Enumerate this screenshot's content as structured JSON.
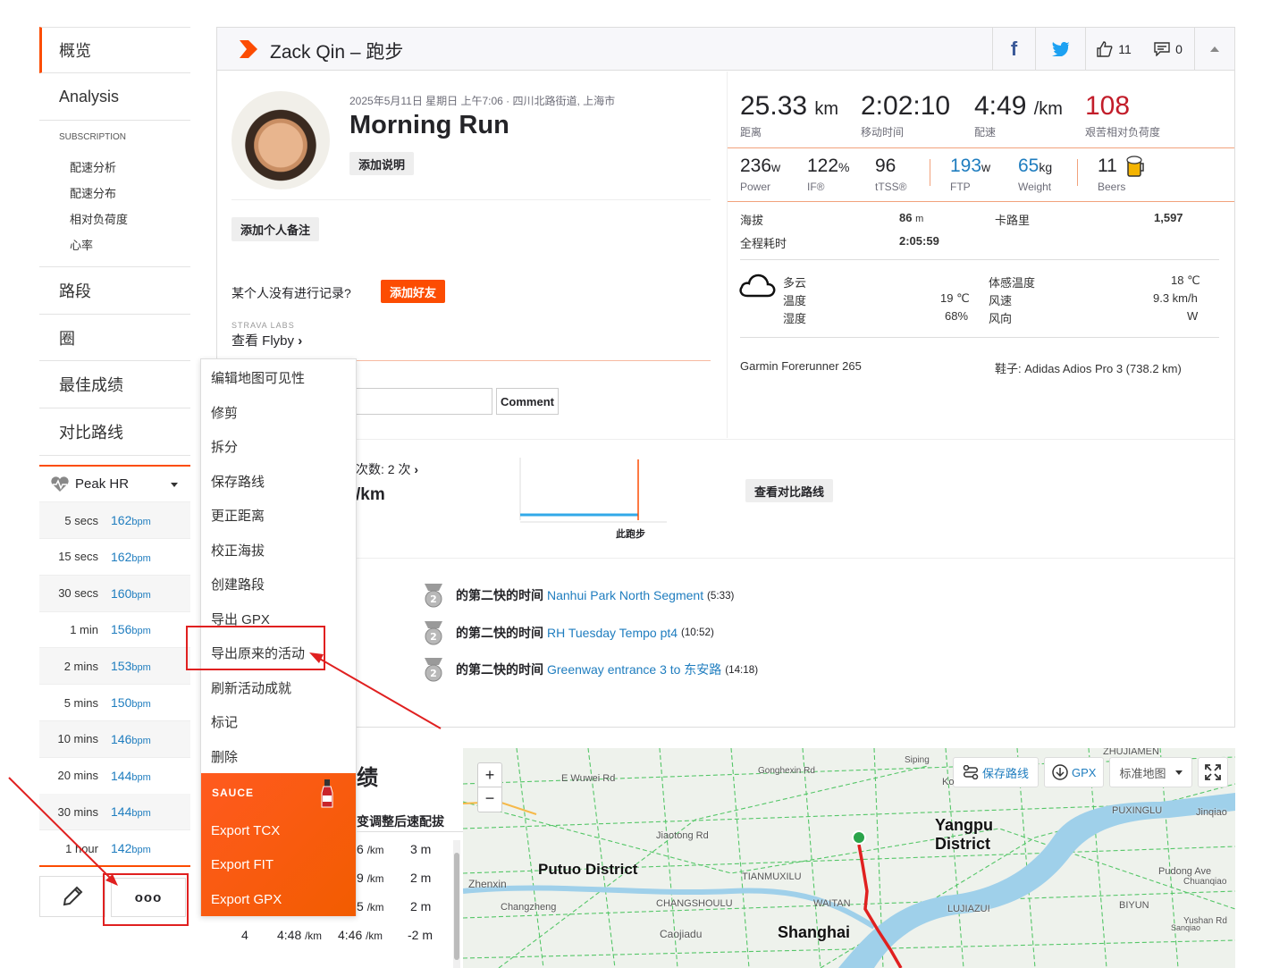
{
  "sidebar": {
    "overview": "概览",
    "analysis": "Analysis",
    "subscription": "SUBSCRIPTION",
    "sub_items": [
      "配速分析",
      "配速分布",
      "相对负荷度",
      "心率"
    ],
    "segments": "路段",
    "laps": "圈",
    "best_efforts": "最佳成绩",
    "matched_runs": "对比路线",
    "peak_hr_label": "Peak HR",
    "peak_hr": [
      {
        "t": "5 secs",
        "v": "162",
        "u": "bpm"
      },
      {
        "t": "15 secs",
        "v": "162",
        "u": "bpm"
      },
      {
        "t": "30 secs",
        "v": "160",
        "u": "bpm"
      },
      {
        "t": "1 min",
        "v": "156",
        "u": "bpm"
      },
      {
        "t": "2 mins",
        "v": "153",
        "u": "bpm"
      },
      {
        "t": "5 mins",
        "v": "150",
        "u": "bpm"
      },
      {
        "t": "10 mins",
        "v": "146",
        "u": "bpm"
      },
      {
        "t": "20 mins",
        "v": "144",
        "u": "bpm"
      },
      {
        "t": "30 mins",
        "v": "144",
        "u": "bpm"
      },
      {
        "t": "1 hour",
        "v": "142",
        "u": "bpm"
      }
    ],
    "more_label": "ooo"
  },
  "header": {
    "title": "Zack Qin – 跑步",
    "kudos": "11",
    "comments": "0"
  },
  "activity": {
    "meta": "2025年5月11日 星期日 上午7:06 · 四川北路街道, 上海市",
    "name": "Morning Run",
    "add_desc": "添加说明",
    "add_note": "添加个人备注",
    "not_recorded": "某个人没有进行记录?",
    "add_friend": "添加好友",
    "labs": "STRAVA LABS",
    "flyby": "查看 Flyby",
    "comment_btn": "Comment"
  },
  "stats": {
    "distance": {
      "v": "25.33",
      "u": "km",
      "l": "距离"
    },
    "moving_time": {
      "v": "2:02:10",
      "l": "移动时间"
    },
    "pace": {
      "v": "4:49",
      "u": "/km",
      "l": "配速"
    },
    "relative_effort": {
      "v": "108",
      "l": "艰苦相对负荷度"
    },
    "power": {
      "v": "236",
      "u": "w",
      "l": "Power"
    },
    "if": {
      "v": "122",
      "u": "%",
      "l": "IF®"
    },
    "tss": {
      "v": "96",
      "l": "tTSS®"
    },
    "ftp": {
      "v": "193",
      "u": "w",
      "l": "FTP"
    },
    "weight": {
      "v": "65",
      "u": "kg",
      "l": "Weight"
    },
    "beers": {
      "v": "11",
      "l": "Beers"
    },
    "elev_label": "海拔",
    "elev_val": "86",
    "elev_unit": "m",
    "cal_label": "卡路里",
    "cal_val": "1,597",
    "elapsed_label": "全程耗时",
    "elapsed_val": "2:05:59"
  },
  "weather": {
    "cond": "多云",
    "temp_label": "温度",
    "temp_val": "19 ℃",
    "hum_label": "湿度",
    "hum_val": "68%",
    "feels_label": "体感温度",
    "feels_val": "18 ℃",
    "wind_label": "风速",
    "wind_val": "9.3 km/h",
    "dir_label": "风向",
    "dir_val": "W"
  },
  "gear": {
    "device": "Garmin Forerunner 265",
    "shoes": "鞋子: Adidas Adios Pro 3 (738.2 km)"
  },
  "compare": {
    "count": "次数: 2 次",
    "pace": "/km",
    "this_run": "此跑步",
    "btn": "查看对比路线"
  },
  "achievements": [
    {
      "pre": "的第二快的时间",
      "seg": "Nanhui Park North Segment",
      "time": "(5:33)"
    },
    {
      "pre": "的第二快的时间",
      "seg": "RH Tuesday Tempo pt4",
      "time": "(10:52)"
    },
    {
      "pre": "的第二快的时间",
      "seg": "Greenway entrance 3 to 东安路",
      "time": "(14:18)"
    }
  ],
  "menu": {
    "items": [
      "编辑地图可见性",
      "修剪",
      "拆分",
      "保存路线",
      "更正距离",
      "校正海拔",
      "创建路段",
      "导出 GPX",
      "导出原来的活动",
      "刷新活动成就",
      "标记",
      "删除"
    ],
    "sauce_title": "SAUCE",
    "sauce_items": [
      "Export TCX",
      "Export FIT",
      "Export GPX"
    ]
  },
  "laps": {
    "heading": "绩",
    "cols": "变调整后速配拔",
    "rows": [
      {
        "a": "6",
        "b": "/km",
        "c": "3 m"
      },
      {
        "a": "9",
        "b": "/km",
        "c": "2 m"
      },
      {
        "a": "5",
        "b": "/km",
        "c": "2 m"
      }
    ],
    "last": {
      "n": "4",
      "p": "4:48",
      "pu": "/km",
      "g": "4:46",
      "gu": "/km",
      "e": "-2 m"
    }
  },
  "map": {
    "save_route": "保存路线",
    "gpx": "GPX",
    "map_type": "标准地图",
    "labels": [
      "Putuo District",
      "Yangpu District",
      "Shanghai",
      "E Wuwei Rd",
      "Jiaotong Rd",
      "Zhenxin",
      "Changzheng",
      "Caojiadu",
      "TIANMUXILU",
      "CHANGSHOULU",
      "WAITAN",
      "LUJIAZUI",
      "BIYUN",
      "PUXINGLU",
      "ZHUJIAMEN",
      "Pudong Ave",
      "Chuanqiao",
      "Yushan Rd",
      "Sanqiao",
      "Jinqiao",
      "Gonghexin Rd",
      "Siping",
      "Ko"
    ]
  }
}
